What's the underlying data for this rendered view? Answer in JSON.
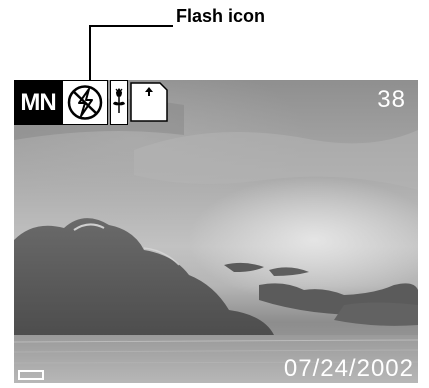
{
  "annotation": {
    "label": "Flash icon"
  },
  "screen": {
    "mode": "MN",
    "flash_icon": "flash-off-icon",
    "macro_icon": "macro-flower-icon",
    "card_icon": "memory-card-icon",
    "shots_remaining": "38",
    "date": "07/24/2002",
    "battery_icon": "battery-icon"
  },
  "colors": {
    "osd_text": "#ffffff",
    "mode_background": "#000000",
    "annotation_text": "#000000"
  }
}
